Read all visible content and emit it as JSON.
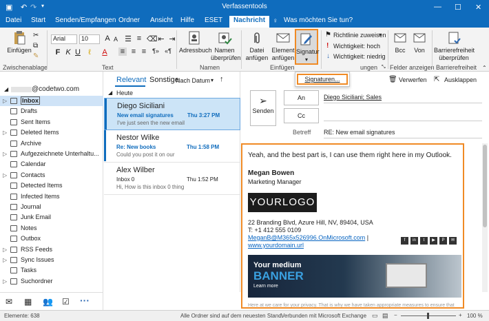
{
  "title": "Verfassentools",
  "search": "Was möchten Sie tun?",
  "tabs": [
    "Datei",
    "Start",
    "Senden/Empfangen",
    "Ordner",
    "Ansicht",
    "Hilfe",
    "ESET",
    "Nachricht"
  ],
  "ribbon": {
    "paste": "Einfügen",
    "clipboard": "Zwischenablage",
    "font": "Arial",
    "size": "10",
    "text_group": "Text",
    "addressbook": "Adressbuch",
    "check_names_1": "Namen",
    "check_names_2": "überprüfen",
    "names_group": "Namen",
    "attach_file_1": "Datei",
    "attach_file_2": "anfügen",
    "attach_item_1": "Element",
    "attach_item_2": "anfügen",
    "signature": "Signatur",
    "insert_group": "Einfügen",
    "policy": "Richtlinie zuweisen",
    "high": "Wichtigkeit: hoch",
    "low": "Wichtigkeit: niedrig",
    "tags_group": "ungen",
    "bcc": "Bcc",
    "from": "Von",
    "fields_group": "Felder anzeigen",
    "access_1": "Barrierefreiheit",
    "access_2": "überprüfen",
    "access_group": "Barrierefreiheit",
    "sig_menu": "Signaturen..."
  },
  "account": "@codetwo.com",
  "folders": [
    "Inbox",
    "Drafts",
    "Sent Items",
    "Deleted Items",
    "Archive",
    "Aufgezeichnete Unterhaltu...",
    "Calendar",
    "Contacts",
    "Detected Items",
    "Infected Items",
    "Journal",
    "Junk Email",
    "Notes",
    "Outbox",
    "RSS Feeds",
    "Sync Issues",
    "Tasks",
    "Suchordner"
  ],
  "list": {
    "relevant": "Relevant",
    "other": "Sonstige",
    "sort": "Nach Datum",
    "today": "Heute",
    "messages": [
      {
        "from": "Diego Siciliani",
        "subject": "New email signatures",
        "time": "Thu 3:27 PM",
        "preview": "I've just seen the new email"
      },
      {
        "from": "Nestor Wilke",
        "subject": "Re: New books",
        "time": "Thu 1:58 PM",
        "preview": "Could you post it on our"
      },
      {
        "from": "Alex Wilber",
        "subject": "Inbox 0",
        "time": "Thu 1:52 PM",
        "preview": "Hi,  How is this inbox 0 thing"
      }
    ]
  },
  "compose": {
    "discard": "Verwerfen",
    "popout": "Ausklappen",
    "send": "Senden",
    "to": "An",
    "cc": "Cc",
    "to_value": "Diego Siciliani; Sales",
    "subject_label": "Betreff",
    "subject": "RE: New email signatures",
    "body": "Yeah, and the best part is, I can use them right here in my Outlook.",
    "sig_name": "Megan Bowen",
    "sig_title": "Marketing Manager",
    "logo": "YOURLOGO",
    "address": "22 Branding Blvd, Azure Hill, NV, 89404, USA",
    "phone": "T: +1 412 555 0109",
    "email": "MeganB@M365x526996.OnMicrosoft.com",
    "sep": " |",
    "website": "www.yourdomain.url",
    "banner_1": "Your medium",
    "banner_2": "BANNER",
    "banner_3": "Learn more",
    "disclaimer": "Here at we care for your privacy. That is why we have taken appropriate measures to ensure that"
  },
  "social": [
    "f",
    "in",
    "t",
    "▶",
    "P",
    "✉"
  ],
  "status": {
    "items": "Elemente: 638",
    "sync": "Alle Ordner sind auf dem neuesten Stand.",
    "conn": "Verbunden mit Microsoft Exchange",
    "zoom": "100 %"
  }
}
